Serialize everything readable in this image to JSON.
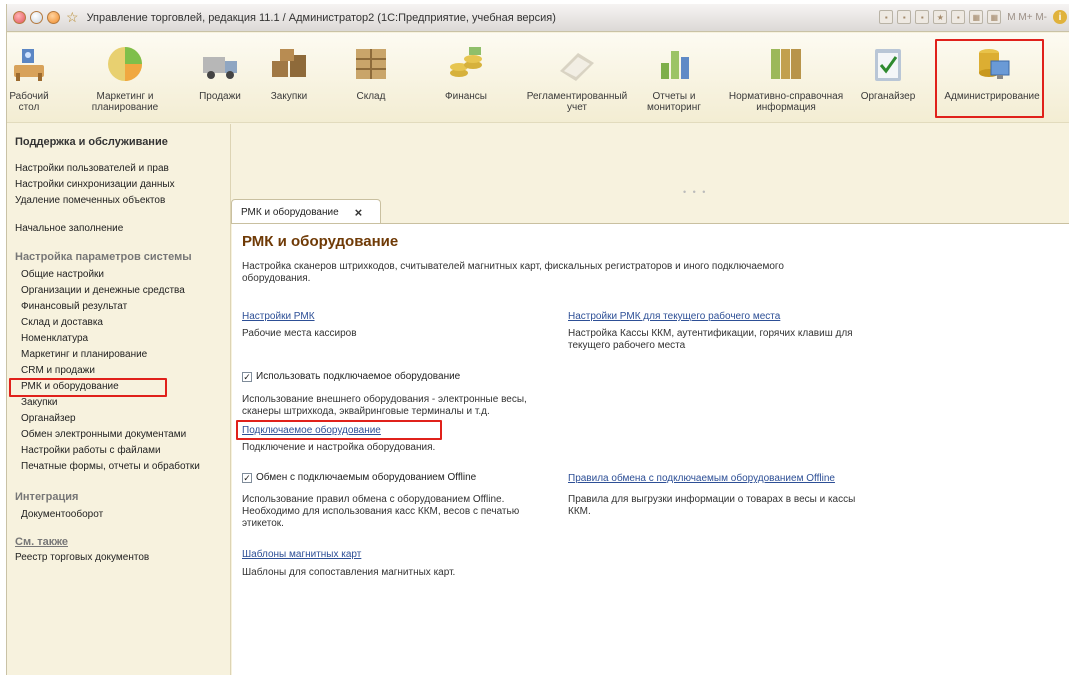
{
  "window": {
    "title": "Управление торговлей, редакция 11.1 / Администратор2 (1С:Предприятие, учебная версия)",
    "toolbar_text": "M  M+  M-"
  },
  "sections": [
    {
      "label": "Рабочий\nстол",
      "icon": "desktop-icon"
    },
    {
      "label": "Маркетинг и\nпланирование",
      "icon": "pie-chart-icon"
    },
    {
      "label": "Продажи",
      "icon": "truck-icon"
    },
    {
      "label": "Закупки",
      "icon": "boxes-icon"
    },
    {
      "label": "Склад",
      "icon": "warehouse-icon"
    },
    {
      "label": "Финансы",
      "icon": "coins-icon"
    },
    {
      "label": "Регламентированный\nучет",
      "icon": "ledger-icon"
    },
    {
      "label": "Отчеты и\nмониторинг",
      "icon": "bar-chart-icon"
    },
    {
      "label": "Нормативно-справочная\nинформация",
      "icon": "folders-icon"
    },
    {
      "label": "Органайзер",
      "icon": "clipboard-icon"
    },
    {
      "label": "Администрирование",
      "icon": "admin-icon"
    }
  ],
  "sidebar": {
    "group1": "Поддержка и обслуживание",
    "group1_items": [
      "Настройки пользователей и прав",
      "Настройки синхронизации данных",
      "Удаление помеченных объектов"
    ],
    "initial_fill": "Начальное заполнение",
    "group2": "Настройка параметров системы",
    "group2_items": [
      "Общие настройки",
      "Организации и денежные средства",
      "Финансовый результат",
      "Склад и доставка",
      "Номенклатура",
      "Маркетинг и планирование",
      "CRM и продажи",
      "РМК и оборудование",
      "Закупки",
      "Органайзер",
      "Обмен электронными документами",
      "Настройки работы с файлами",
      "Печатные формы, отчеты и обработки"
    ],
    "group3": "Интеграция",
    "group3_items": [
      "Документооборот"
    ],
    "group4": "См. также",
    "group4_items": [
      "Реестр торговых документов"
    ]
  },
  "tab": {
    "label": "РМК и оборудование",
    "close": "×"
  },
  "main": {
    "title": "РМК и оборудование",
    "description": "Настройка сканеров штрихкодов, считывателей магнитных карт, фискальных регистраторов и иного подключаемого\nоборудования.",
    "rmk_settings_link": "Настройки РМК",
    "rmk_settings_desc": "Рабочие места кассиров",
    "rmk_current_link": "Настройки РМК для текущего рабочего места",
    "rmk_current_desc": "Настройка Кассы ККМ, аутентификации, горячих клавиш для\nтекущего рабочего места",
    "use_equipment_label": "Использовать подключаемое оборудование",
    "use_equipment_desc": "Использование внешнего оборудования - электронные весы,\nсканеры штрихкода, эквайринговые терминалы и т.д.",
    "equipment_link": "Подключаемое оборудование",
    "equipment_desc": "Подключение и настройка оборудования.",
    "offline_label": "Обмен с подключаемым оборудованием Offline",
    "offline_desc": "Использование правил обмена с оборудованием Offline.\nНеобходимо для использования касс ККМ, весов с печатью\nэтикеток.",
    "offline_rules_link": "Правила обмена с подключаемым оборудованием Offline",
    "offline_rules_desc": "Правила для выгрузки информации о товарах в весы и кассы\nККМ.",
    "cards_link": "Шаблоны магнитных карт",
    "cards_desc": "Шаблоны для сопоставления магнитных карт."
  },
  "colors": {
    "highlight": "#e0211b",
    "link": "#2d4f96",
    "title": "#6f3a06",
    "panel": "#f7f2de"
  }
}
